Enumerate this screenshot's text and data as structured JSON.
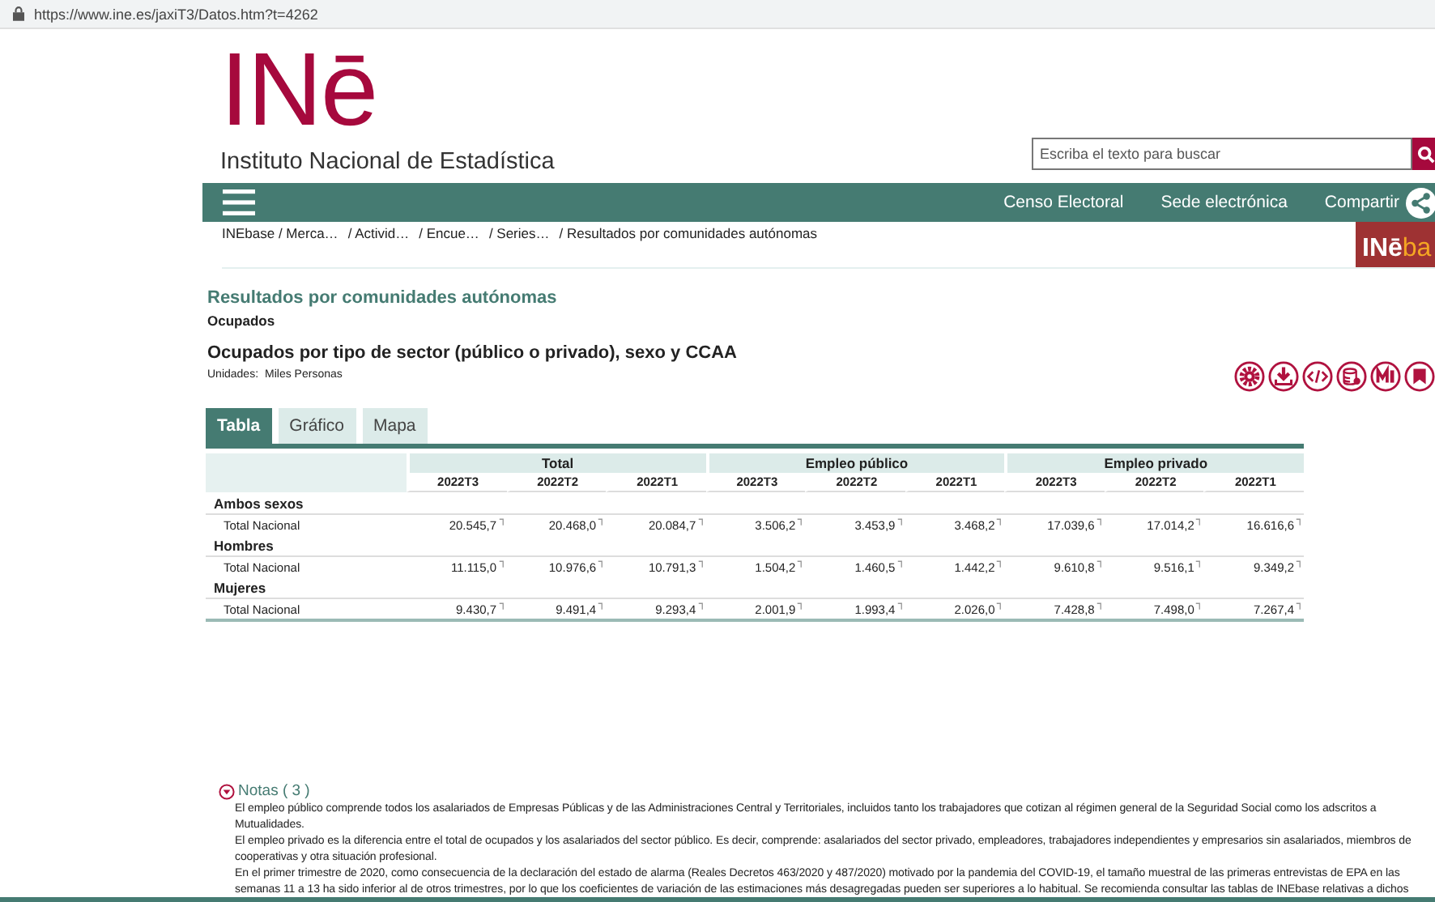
{
  "browser": {
    "url": "https://www.ine.es/jaxiT3/Datos.htm?t=4262"
  },
  "header": {
    "logo": "INē",
    "subtitle": "Instituto Nacional de Estadística",
    "search": {
      "placeholder": "Escriba el texto para buscar"
    }
  },
  "nav": {
    "links": [
      "Censo Electoral",
      "Sede electrónica",
      "Compartir"
    ]
  },
  "breadcrumb": [
    "INEbase / Merca…",
    "/ Activid…",
    "/ Encue…",
    "/ Series…",
    "/ Resultados por comunidades autónomas"
  ],
  "inebase_logo": {
    "part_1": "INē",
    "part_2": "ba"
  },
  "page": {
    "title": "Resultados por comunidades autónomas",
    "subtitle": "Ocupados",
    "table_title": "Ocupados por tipo de sector (público o privado), sexo y CCAA",
    "units_label": "Unidades:",
    "units": "Miles Personas"
  },
  "tabs": [
    {
      "label": "Tabla",
      "selected": true
    },
    {
      "label": "Gráfico",
      "selected": false
    },
    {
      "label": "Mapa",
      "selected": false
    }
  ],
  "table": {
    "groups": [
      "Total",
      "Empleo público",
      "Empleo privado"
    ],
    "periods": [
      "2022T3",
      "2022T2",
      "2022T1",
      "2022T3",
      "2022T2",
      "2022T1",
      "2022T3",
      "2022T2",
      "2022T1"
    ],
    "sections": [
      {
        "label": "Ambos sexos",
        "rows": [
          {
            "label": "Total Nacional",
            "values": [
              "20.545,7",
              "20.468,0",
              "20.084,7",
              "3.506,2",
              "3.453,9",
              "3.468,2",
              "17.039,6",
              "17.014,2",
              "16.616,6"
            ]
          }
        ]
      },
      {
        "label": "Hombres",
        "rows": [
          {
            "label": "Total Nacional",
            "values": [
              "11.115,0",
              "10.976,6",
              "10.791,3",
              "1.504,2",
              "1.460,5",
              "1.442,2",
              "9.610,8",
              "9.516,1",
              "9.349,2"
            ]
          }
        ]
      },
      {
        "label": "Mujeres",
        "rows": [
          {
            "label": "Total Nacional",
            "values": [
              "9.430,7",
              "9.491,4",
              "9.293,4",
              "2.001,9",
              "1.993,4",
              "2.026,0",
              "7.428,8",
              "7.498,0",
              "7.267,4"
            ]
          }
        ]
      }
    ]
  },
  "notes": {
    "title": "Notas ( 3 )",
    "expanded": true,
    "paragraphs": [
      "El empleo público comprende todos los asalariados de Empresas Públicas y de las Administraciones Central y Territoriales, incluidos tanto los trabajadores que cotizan al régimen general de la Seguridad Social como los adscritos a Mutualidades.",
      "El empleo privado es la diferencia entre el total de ocupados y los asalariados del sector público. Es decir, comprende: asalariados del sector privado, empleadores, trabajadores independientes y empresarios sin asalariados, miembros de cooperativas y otra situación profesional.",
      "En el primer trimestre de 2020, como consecuencia de la declaración del estado de alarma (Reales Decretos 463/2020 y 487/2020) motivado por la pandemia del COVID-19, el tamaño muestral de las primeras entrevistas de EPA en las semanas 11 a 13 ha sido inferior al de otros trimestres, por lo que los coeficientes de variación de las estimaciones más desagregadas pueden ser superiores a lo habitual. Se recomienda consultar las tablas de INEbase relativas a dichos"
    ]
  }
}
